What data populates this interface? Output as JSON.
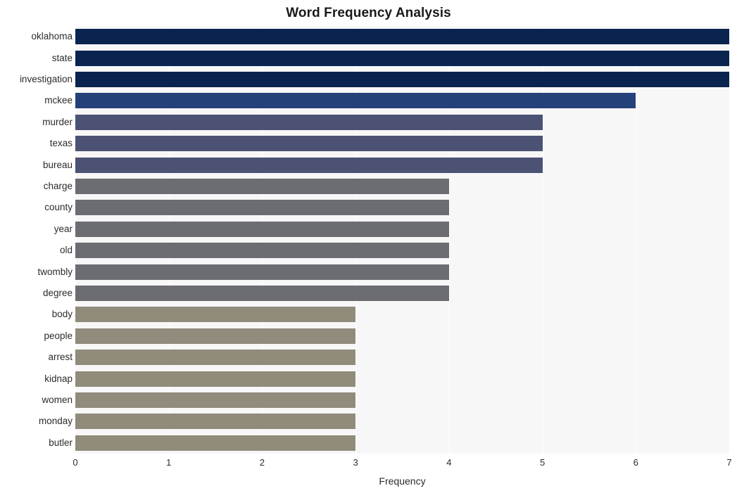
{
  "chart_data": {
    "type": "bar",
    "orientation": "horizontal",
    "title": "Word Frequency Analysis",
    "xlabel": "Frequency",
    "ylabel": "",
    "xlim": [
      0,
      7
    ],
    "xticks": [
      "0",
      "1",
      "2",
      "3",
      "4",
      "5",
      "6",
      "7"
    ],
    "grid": true,
    "legend": null,
    "categories": [
      "oklahoma",
      "state",
      "investigation",
      "mckee",
      "murder",
      "texas",
      "bureau",
      "charge",
      "county",
      "year",
      "old",
      "twombly",
      "degree",
      "body",
      "people",
      "arrest",
      "kidnap",
      "women",
      "monday",
      "butler"
    ],
    "values": [
      7,
      7,
      7,
      6,
      5,
      5,
      5,
      4,
      4,
      4,
      4,
      4,
      4,
      3,
      3,
      3,
      3,
      3,
      3,
      3
    ],
    "bar_colors": [
      "#0a2450",
      "#0a2450",
      "#0a2450",
      "#25417a",
      "#4c5273",
      "#4c5273",
      "#4c5273",
      "#6b6d72",
      "#6b6d72",
      "#6b6d72",
      "#6b6d72",
      "#6b6d72",
      "#6b6d72",
      "#908b7b",
      "#908b7b",
      "#908b7b",
      "#908b7b",
      "#908b7b",
      "#908b7b",
      "#908b7b"
    ]
  },
  "style": {
    "plot_background": "#f7f7f7",
    "gridline_color": "#ffffff",
    "page_background": "#ffffff",
    "text_color": "#2b2b2b",
    "title_color": "#1a1a1a"
  }
}
